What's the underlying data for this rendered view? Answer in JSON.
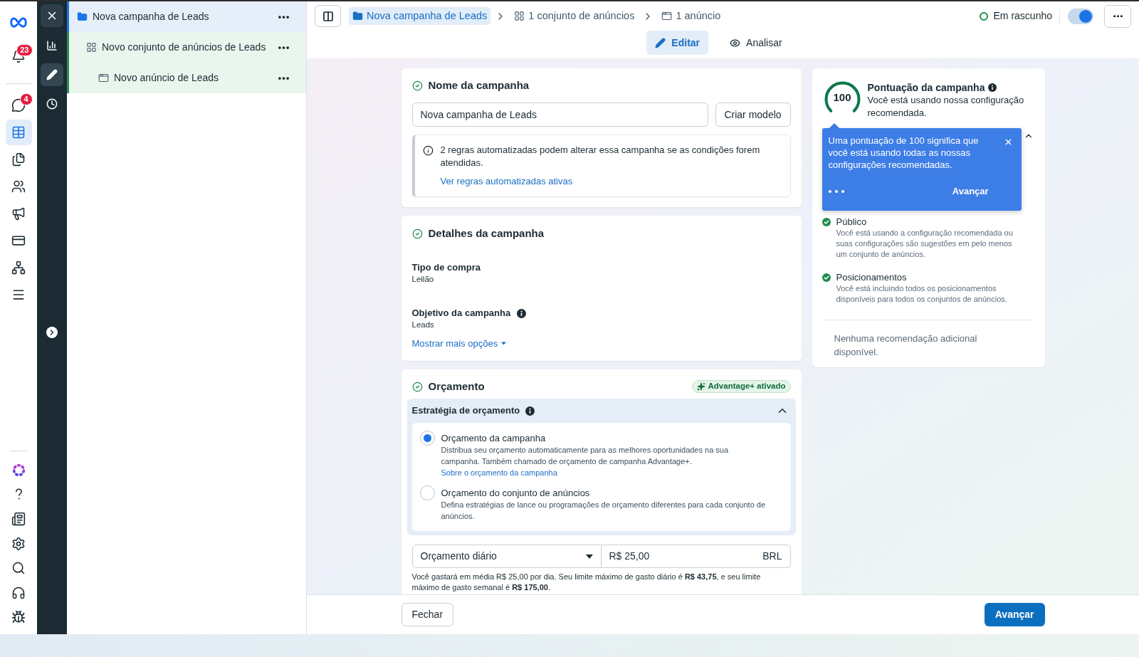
{
  "nav_rail": {
    "items": [
      {
        "badge": "23",
        "selected": false
      },
      {
        "badge": "4",
        "selected": false
      },
      {
        "selected": true
      },
      {
        "selected": false
      },
      {
        "selected": false
      },
      {
        "selected": false
      },
      {
        "selected": false
      },
      {
        "selected": false
      },
      {
        "selected": false
      }
    ]
  },
  "tool_rail": {
    "items": [
      {
        "selected": false
      },
      {
        "selected": true
      },
      {
        "selected": false
      }
    ]
  },
  "tree": {
    "items": [
      {
        "kind": "campaign",
        "label": "Nova campanha de Leads",
        "selected": true,
        "children": [
          {
            "kind": "ad_set",
            "label": "Novo conjunto de anúncios de Leads",
            "selected": false,
            "children": [
              {
                "kind": "ad",
                "label": "Novo anúncio de Leads",
                "selected": false
              }
            ]
          }
        ]
      }
    ]
  },
  "top_bar": {
    "breadcrumb": [
      {
        "kind": "campaign",
        "label": "Nova campanha de Leads",
        "selected": true
      },
      {
        "kind": "ad_set",
        "label": "1 conjunto de anúncios",
        "selected": false
      },
      {
        "kind": "ad",
        "label": "1 anúncio",
        "selected": false
      }
    ],
    "status": "Em rascunho",
    "toggle": {
      "on": true
    }
  },
  "mode_tabs": [
    {
      "label": "Editar",
      "selected": true
    },
    {
      "label": "Analisar",
      "selected": false
    }
  ],
  "campaign_name_card": {
    "title": "Nome da campanha",
    "name_field": {
      "value": "Nova campanha de Leads"
    },
    "template_button": "Criar modelo",
    "notice": {
      "text": "2 regras automatizadas podem alterar essa campanha se as condições forem atendidas.",
      "link": "Ver regras automatizadas ativas"
    }
  },
  "details_card": {
    "title": "Detalhes da campanha",
    "fields": [
      {
        "label": "Tipo de compra",
        "value": "Leilão",
        "info": false
      },
      {
        "label": "Objetivo da campanha",
        "value": "Leads",
        "info": true
      }
    ],
    "more_link": "Mostrar mais opções"
  },
  "budget_card": {
    "title": "Orçamento",
    "badge": "Advantage+ ativado",
    "strategy": {
      "title": "Estratégia de orçamento",
      "expanded": true,
      "options": [
        {
          "title": "Orçamento da campanha",
          "description": "Distribua seu orçamento automaticamente para as melhores oportunidades na sua campanha. Também chamado de orçamento de campanha Advantage+.",
          "link": "Sobre o orçamento da campanha",
          "selected": true
        },
        {
          "title": "Orçamento do conjunto de anúncios",
          "description": "Defina estratégias de lance ou programações de orçamento diferentes para cada conjunto de anúncios.",
          "selected": false
        }
      ]
    },
    "budget_type": {
      "value": "Orçamento diário"
    },
    "amount": {
      "value": "R$ 25,00",
      "currency": "BRL"
    },
    "note": "Você gastará em média R$ 25,00 por dia. Seu limite máximo de gasto diário é **R$ 43,75**, e seu limite máximo de gasto semanal é **R$ 175,00**."
  },
  "score_card": {
    "score": "100",
    "level": 1,
    "title": "Pontuação da campanha",
    "subtitle": "Você está usando nossa configuração recomendada.",
    "tooltip": {
      "text": "Uma pontuação de 100 significa que você está usando todas as nossas configurações recomendadas.",
      "next": "Avançar"
    },
    "items": [
      {
        "title": "Público",
        "description": "Você está usando a configuração recomendada ou suas configurações são sugestões em pelo menos um conjunto de anúncios."
      },
      {
        "title": "Posicionamentos",
        "description": "Você está incluindo todos os posicionamentos disponíveis para todos os conjuntos de anúncios."
      }
    ],
    "footer": "Nenhuma recomendação adicional disponível."
  },
  "footer": {
    "close": "Fechar",
    "next": "Avançar"
  }
}
